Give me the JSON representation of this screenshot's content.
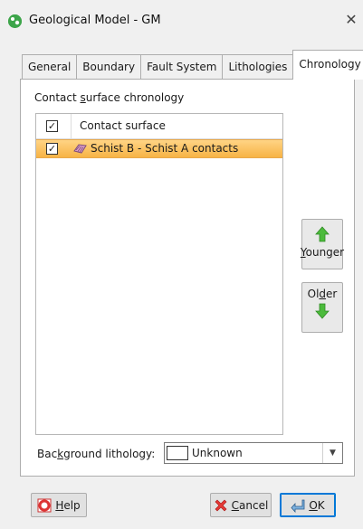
{
  "window": {
    "title": "Geological Model - GM",
    "icon": "geo-model-icon",
    "close_label": "✕"
  },
  "tabs": [
    {
      "label": "General",
      "active": false
    },
    {
      "label": "Boundary",
      "active": false
    },
    {
      "label": "Fault System",
      "active": false
    },
    {
      "label": "Lithologies",
      "active": false
    },
    {
      "label": "Chronology",
      "active": true
    }
  ],
  "chronology": {
    "section_label_pre": "Contact ",
    "section_label_mnemonic": "s",
    "section_label_post": "urface chronology",
    "list": {
      "header": {
        "checked": true,
        "label": "Contact surface"
      },
      "rows": [
        {
          "checked": true,
          "label": "Schist B - Schist A contacts",
          "icon": "contact-surface-icon",
          "selected": true
        }
      ]
    },
    "younger_button": {
      "mnemonic": "Y",
      "rest": "ounger",
      "icon": "arrow-up-icon"
    },
    "older_button": {
      "pre": "Ol",
      "mnemonic": "d",
      "post": "er",
      "icon": "arrow-down-icon"
    },
    "background": {
      "label_pre": "Bac",
      "label_mnemonic": "k",
      "label_post": "ground lithology:",
      "value": "Unknown",
      "swatch_color": "#ffffff"
    }
  },
  "footer": {
    "help": {
      "mnemonic": "H",
      "rest": "elp",
      "icon": "help-lifebuoy-icon"
    },
    "cancel": {
      "mnemonic": "C",
      "rest": "ancel",
      "icon": "cancel-x-icon"
    },
    "ok": {
      "mnemonic": "O",
      "rest": "K",
      "icon": "ok-arrow-icon"
    }
  },
  "colors": {
    "selection_top": "#ffd485",
    "selection_bottom": "#f7b345",
    "arrow_green": "#4cbb3c",
    "ok_border": "#0078d7"
  }
}
